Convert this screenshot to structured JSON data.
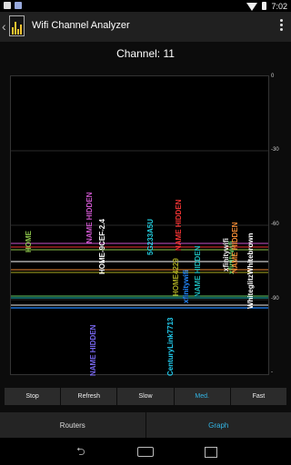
{
  "status_bar": {
    "time": "7:02"
  },
  "app": {
    "title": "Wifi Channel Analyzer"
  },
  "channel_label": "Channel: 11",
  "graph": {
    "y_axis_labels": [
      "0",
      "-30",
      "-60",
      "-90",
      "-"
    ],
    "networks": [
      {
        "name": "HOME",
        "color": "#8bc34a"
      },
      {
        "name": "NAME HIDDEN",
        "color": "#cc55cc"
      },
      {
        "name": "HOME-9CEF-2.4",
        "color": "#ffffff"
      },
      {
        "name": "5G233A5U",
        "color": "#22ccdd"
      },
      {
        "name": "NAME HIDDEN",
        "color": "#ee3333"
      },
      {
        "name": "HOME4229",
        "color": "#aaaa22"
      },
      {
        "name": "xfinitywifi",
        "color": "#2288ff"
      },
      {
        "name": "NAME HIDDEN",
        "color": "#1cb8b8"
      },
      {
        "name": "xfinitywifi",
        "color": "#eeeeee"
      },
      {
        "name": "xfinitywifi",
        "color": "#66cc66"
      },
      {
        "name": "NAME HIDDEN",
        "color": "#ee8833"
      },
      {
        "name": "WhiteglitzWhitebrown",
        "color": "#ffffff"
      },
      {
        "name": "NAME HIDDEN",
        "color": "#7766ee"
      },
      {
        "name": "CenturyLink7713",
        "color": "#22ccee"
      }
    ]
  },
  "controls": {
    "stop": "Stop",
    "refresh": "Refresh",
    "slow": "Slow",
    "med": "Med.",
    "fast": "Fast"
  },
  "tabs": {
    "routers": "Routers",
    "graph": "Graph"
  },
  "colors": {
    "accent": "#33b5e5"
  }
}
